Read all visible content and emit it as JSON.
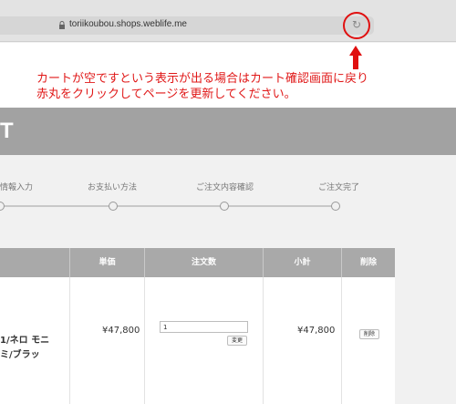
{
  "browser": {
    "url": "toriikoubou.shops.weblife.me",
    "reload_icon": "reload-icon",
    "lock_icon": "lock-icon"
  },
  "annotation": {
    "line1": "カートが空ですという表示が出る場合はカート確認画面に戻り",
    "line2": "赤丸をクリックしてページを更新してください。",
    "color": "#e01818"
  },
  "header": {
    "title_fragment": "T"
  },
  "steps": [
    {
      "label": "情報入力"
    },
    {
      "label": "お支払い方法"
    },
    {
      "label": "ご注文内容確認"
    },
    {
      "label": "ご注文完了"
    }
  ],
  "cart_table": {
    "columns": [
      "単価",
      "注文数",
      "小計",
      "削除"
    ],
    "rows": [
      {
        "name_line1": "1/ネロ モニ",
        "name_line2": "ミ/ブラッ",
        "unit_price": "¥47,800",
        "quantity": "1",
        "update_label": "変更",
        "subtotal": "¥47,800",
        "delete_label": "削除"
      }
    ]
  }
}
